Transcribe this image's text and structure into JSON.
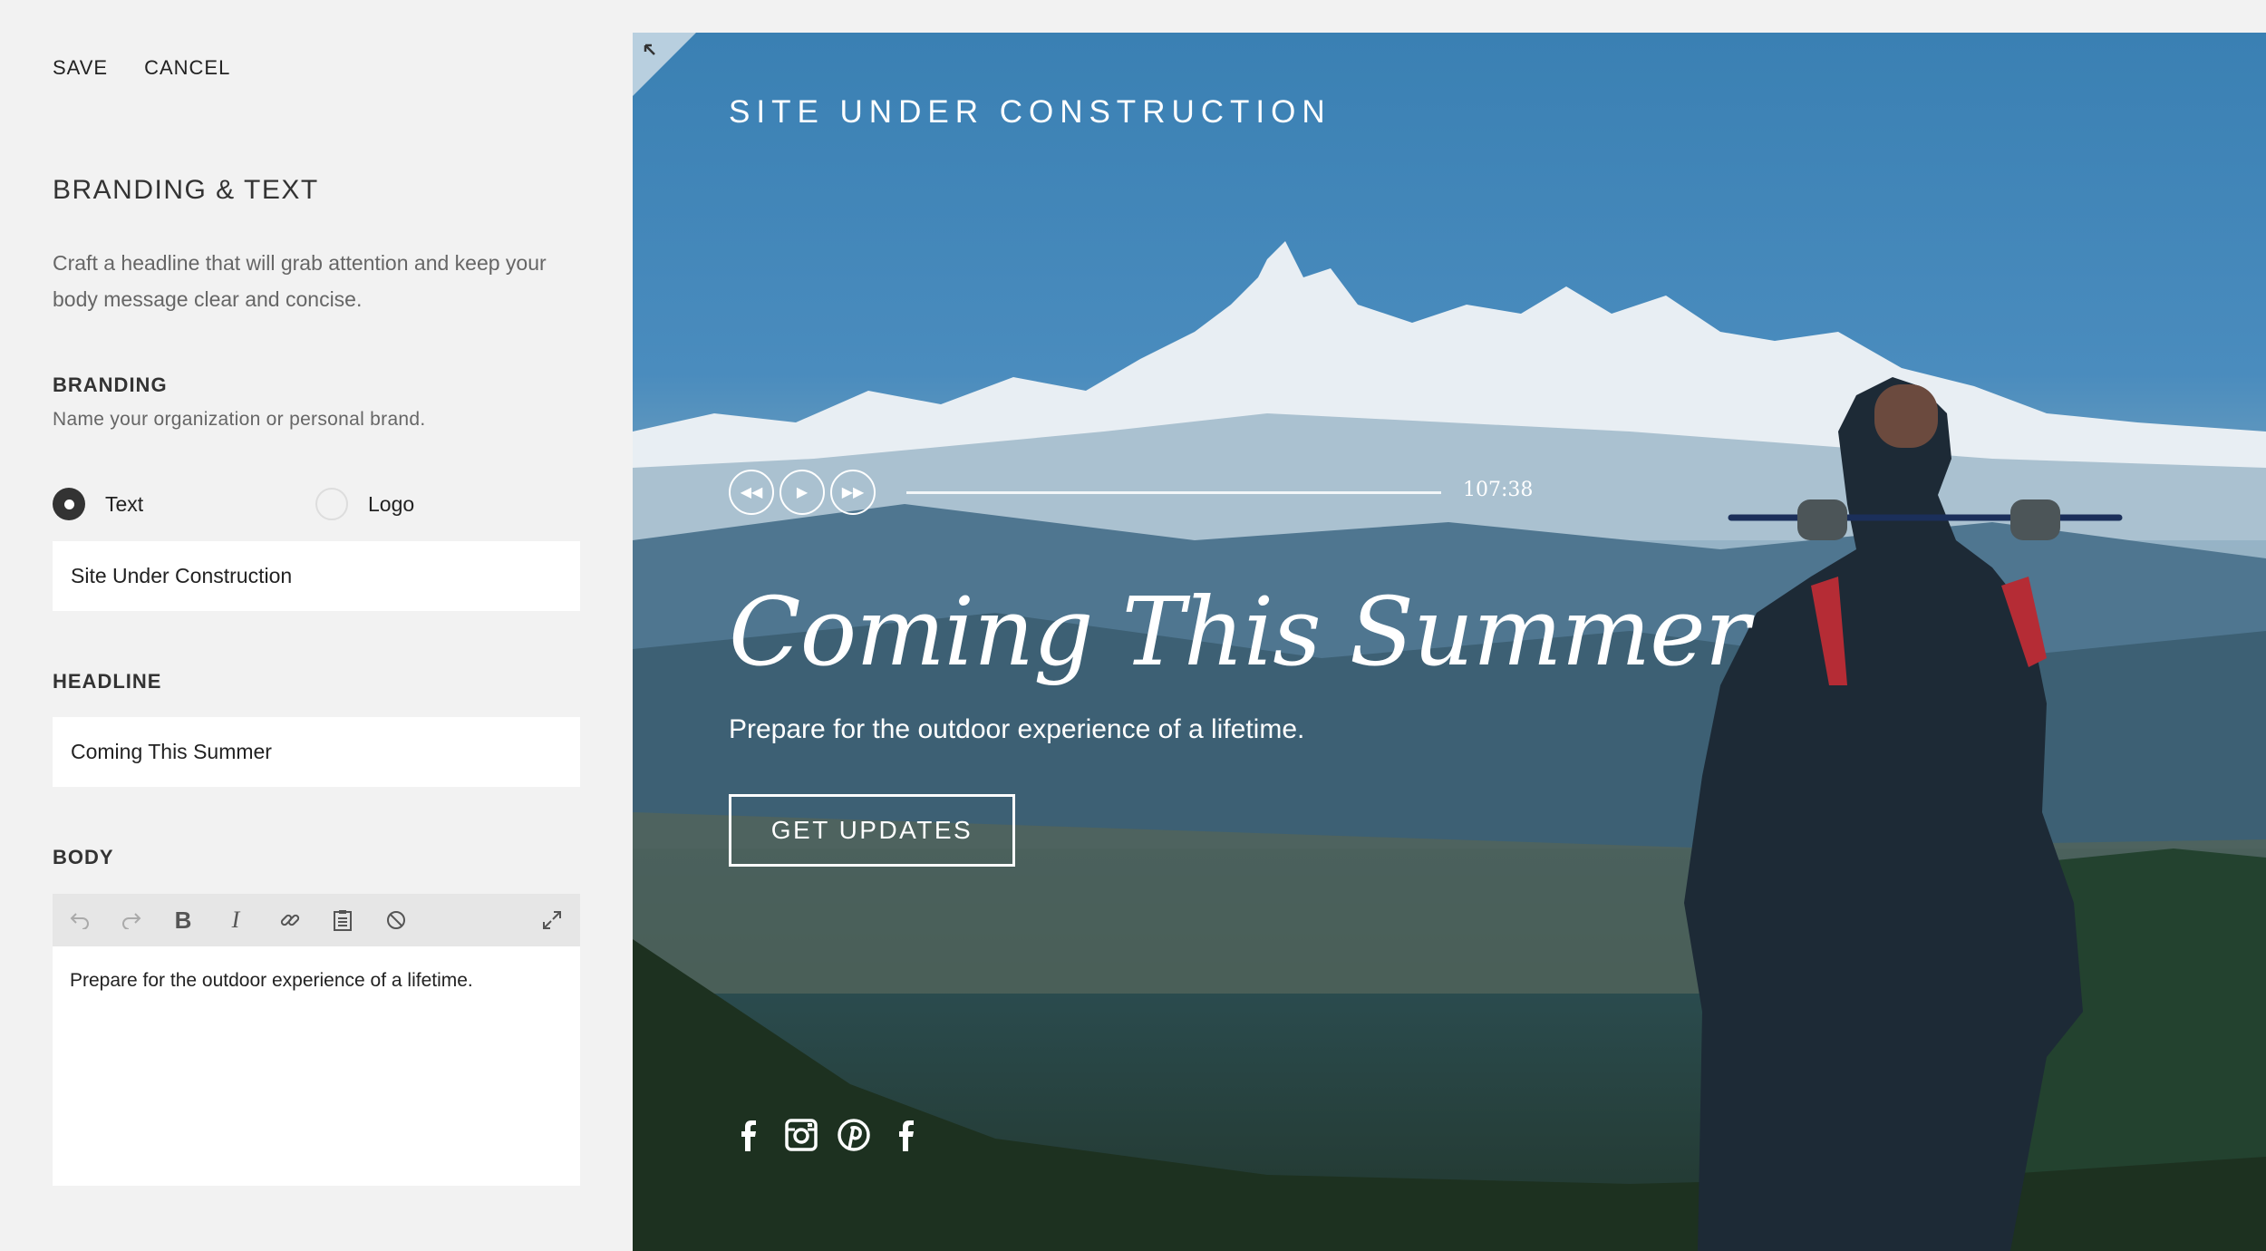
{
  "topbar": {
    "save_label": "SAVE",
    "cancel_label": "CANCEL"
  },
  "section": {
    "title": "BRANDING & TEXT",
    "intro": "Craft a headline that will grab attention and keep your body message clear and concise."
  },
  "branding": {
    "label": "BRANDING",
    "sublabel": "Name your organization or personal brand.",
    "option_text": "Text",
    "option_logo": "Logo",
    "selected": "Text",
    "value": "Site Under Construction"
  },
  "headline": {
    "label": "HEADLINE",
    "value": "Coming This Summer"
  },
  "body": {
    "label": "BODY",
    "value": "Prepare for the outdoor experience of a lifetime."
  },
  "toolbar_icons": [
    "undo-icon",
    "redo-icon",
    "bold-icon",
    "italic-icon",
    "link-icon",
    "paste-icon",
    "clear-format-icon",
    "expand-icon"
  ],
  "preview": {
    "site_title": "SITE UNDER CONSTRUCTION",
    "player_time": "107:38",
    "headline": "Coming This Summer",
    "body": "Prepare for the outdoor experience of a lifetime.",
    "cta_label": "GET UPDATES",
    "social": [
      "facebook-icon",
      "instagram-icon",
      "pinterest-icon",
      "facebook-icon"
    ]
  }
}
